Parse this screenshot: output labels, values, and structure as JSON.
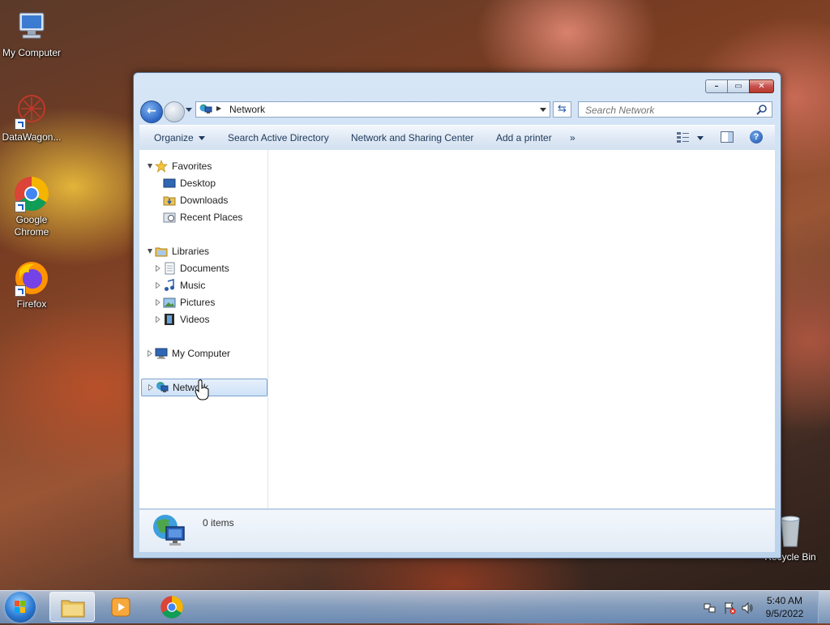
{
  "desktop": {
    "icons": [
      {
        "label": "My Computer",
        "icon": "computer-icon"
      },
      {
        "label": "DataWagon...",
        "icon": "datawagon-icon"
      },
      {
        "label": "Google Chrome",
        "icon": "chrome-icon"
      },
      {
        "label": "Firefox",
        "icon": "firefox-icon"
      },
      {
        "label": "Recycle Bin",
        "icon": "recycle-bin-icon"
      }
    ]
  },
  "window": {
    "address": {
      "location": "Network"
    },
    "search": {
      "placeholder": "Search Network"
    },
    "commands": {
      "organize": "Organize",
      "search_ad": "Search Active Directory",
      "sharing_center": "Network and Sharing Center",
      "add_printer": "Add a printer",
      "more": "»"
    },
    "help": "?",
    "tree": {
      "favorites": "Favorites",
      "desktop": "Desktop",
      "downloads": "Downloads",
      "recent": "Recent Places",
      "libraries": "Libraries",
      "documents": "Documents",
      "music": "Music",
      "pictures": "Pictures",
      "videos": "Videos",
      "my_computer": "My Computer",
      "network": "Network"
    },
    "details": {
      "count": "0 items"
    }
  },
  "taskbar": {
    "clock": {
      "time": "5:40 AM",
      "date": "9/5/2022"
    }
  }
}
